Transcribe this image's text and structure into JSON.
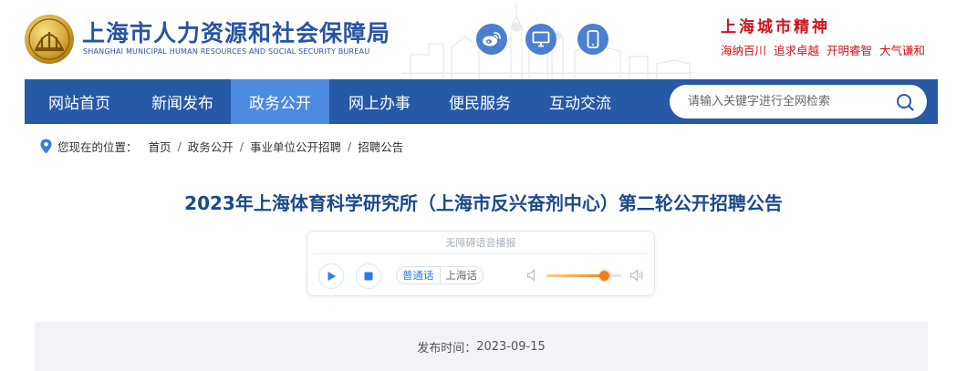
{
  "header": {
    "title_cn": "上海市人力资源和社会保障局",
    "title_en": "SHANGHAI MUNICIPAL HUMAN RESOURCES AND SOCIAL SECURITY BUREAU",
    "social_icons": [
      "weibo-icon",
      "computer-icon",
      "mobile-icon"
    ],
    "spirit": {
      "title": "上海城市精神",
      "words": [
        "海纳百川",
        "追求卓越",
        "开明睿智",
        "大气谦和"
      ]
    }
  },
  "nav": {
    "items": [
      {
        "label": "网站首页",
        "active": false
      },
      {
        "label": "新闻发布",
        "active": false
      },
      {
        "label": "政务公开",
        "active": true
      },
      {
        "label": "网上办事",
        "active": false
      },
      {
        "label": "便民服务",
        "active": false
      },
      {
        "label": "互动交流",
        "active": false
      }
    ],
    "search_placeholder": "请输入关键字进行全网检索"
  },
  "breadcrumb": {
    "label": "您现在的位置：",
    "items": [
      "首页",
      "政务公开",
      "事业单位公开招聘",
      "招聘公告"
    ]
  },
  "article": {
    "title": "2023年上海体育科学研究所（上海市反兴奋剂中心）第二轮公开招聘公告",
    "publish_label": "发布时间：",
    "publish_date": "2023-09-15"
  },
  "player": {
    "title": "无障碍语音播报",
    "dialects": [
      "普通话",
      "上海话"
    ],
    "selected_dialect": "普通话",
    "volume": 0.77
  },
  "colors": {
    "brand_blue": "#2659a6",
    "nav_active": "#4e8ae0",
    "title_blue": "#1a4a8a",
    "spirit_red": "#d0121b",
    "volume_orange": "#f0801a"
  }
}
